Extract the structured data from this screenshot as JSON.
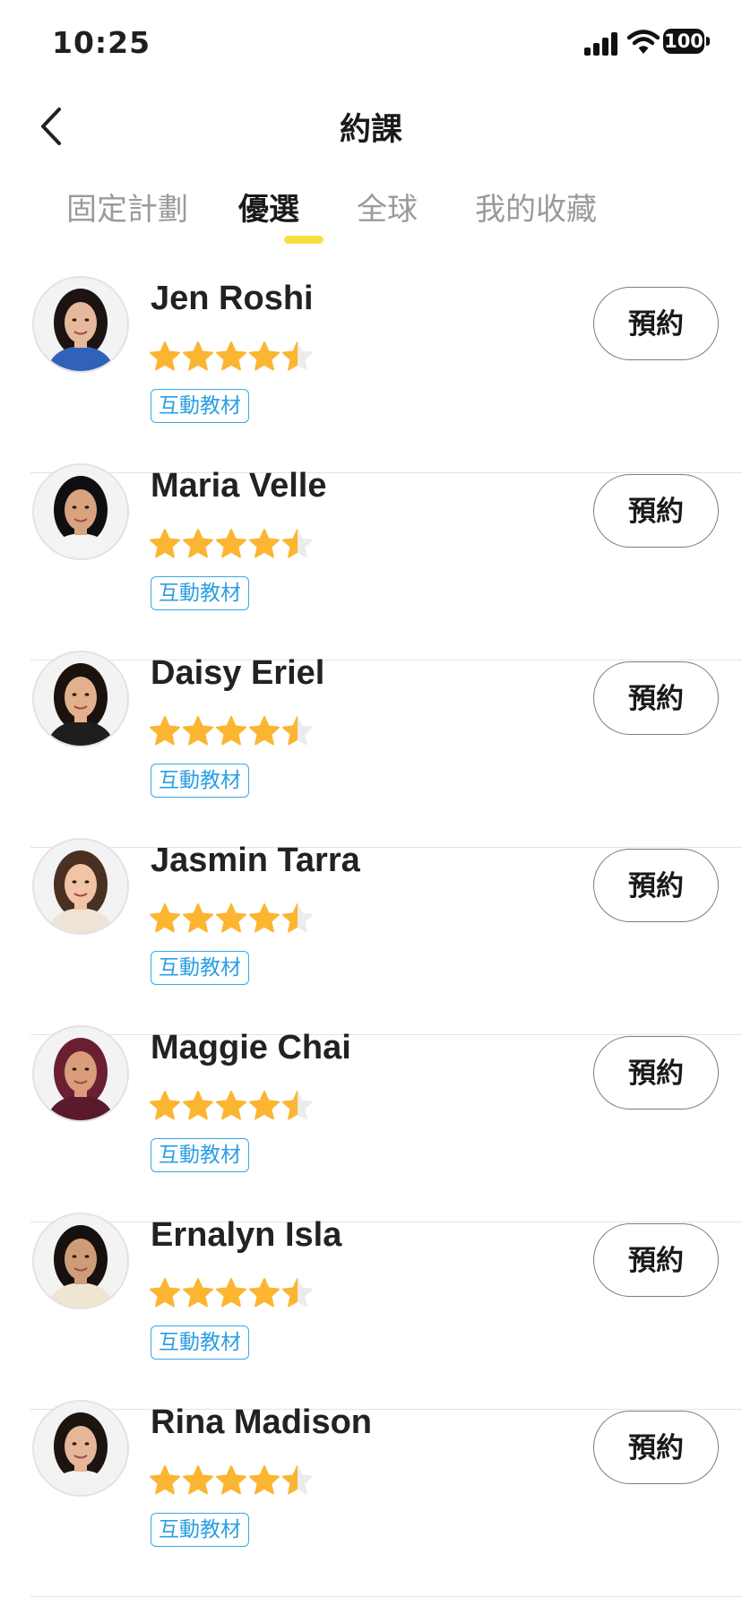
{
  "status": {
    "time": "10:25",
    "battery": "100"
  },
  "header": {
    "title": "約課"
  },
  "tabs": [
    {
      "label": "固定計劃",
      "active": false
    },
    {
      "label": "優選",
      "active": true
    },
    {
      "label": "全球",
      "active": false
    },
    {
      "label": "我的收藏",
      "active": false
    }
  ],
  "colors": {
    "accent": "#f7e23b",
    "star": "#fbb531",
    "tag": "#2b9fe3"
  },
  "teachers": [
    {
      "name": "Jen Roshi",
      "rating": 4.5,
      "tag": "互動教材",
      "book": "預約",
      "hair": "#1c1412",
      "skin": "#e7b99c",
      "cloth": "#2f62b8"
    },
    {
      "name": "Maria Velle",
      "rating": 4.5,
      "tag": "互動教材",
      "book": "預約",
      "hair": "#0f0f12",
      "skin": "#d8a47f",
      "cloth": "#f4f4f4"
    },
    {
      "name": "Daisy Eriel",
      "rating": 4.5,
      "tag": "互動教材",
      "book": "預約",
      "hair": "#1a120e",
      "skin": "#e2b08c",
      "cloth": "#1e1e1e"
    },
    {
      "name": "Jasmin Tarra",
      "rating": 4.5,
      "tag": "互動教材",
      "book": "預約",
      "hair": "#4a3022",
      "skin": "#f0c4a4",
      "cloth": "#ede4d6"
    },
    {
      "name": "Maggie Chai",
      "rating": 4.5,
      "tag": "互動教材",
      "book": "預約",
      "hair": "#6b1f32",
      "skin": "#d99d7c",
      "cloth": "#5b1a2c"
    },
    {
      "name": "Ernalyn Isla",
      "rating": 4.5,
      "tag": "互動教材",
      "book": "預約",
      "hair": "#16110e",
      "skin": "#cf9c78",
      "cloth": "#efe6d2"
    },
    {
      "name": "Rina Madison",
      "rating": 4.5,
      "tag": "互動教材",
      "book": "預約",
      "hair": "#1b1410",
      "skin": "#e6b698",
      "cloth": "#f2f2f2"
    }
  ]
}
